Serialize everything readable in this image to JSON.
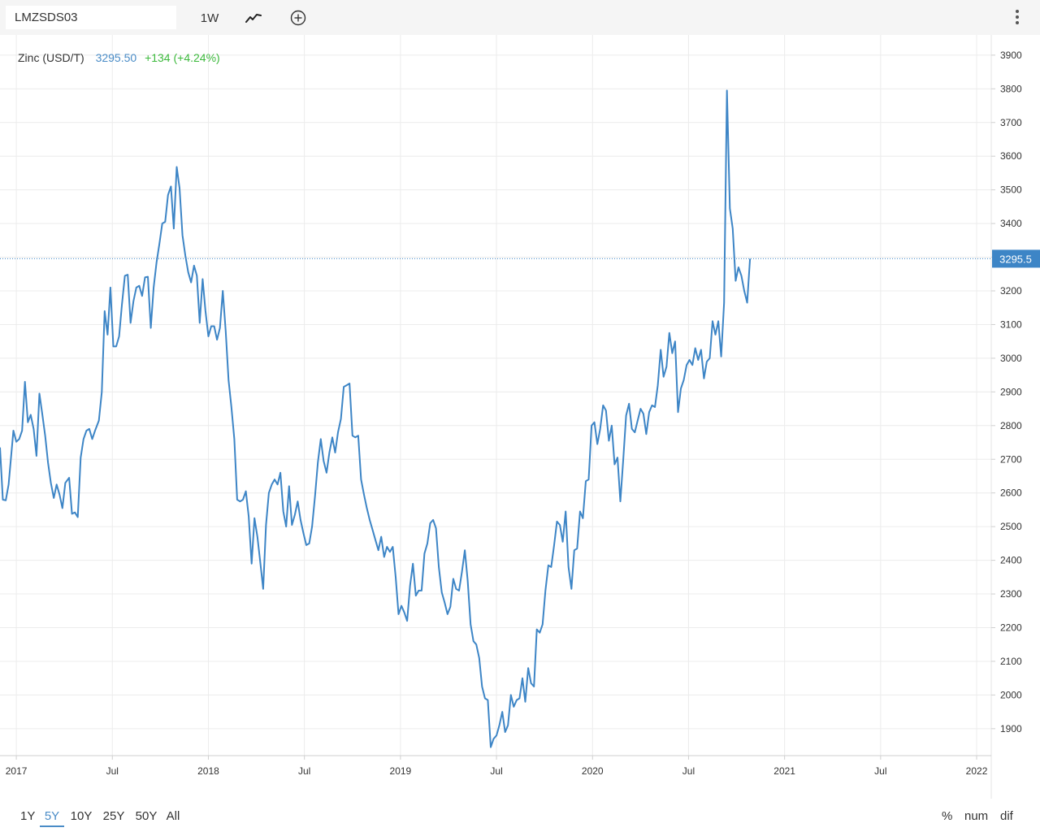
{
  "toolbar": {
    "symbol": "LMZSDS03",
    "interval": "1W",
    "icons": [
      "line-chart-icon",
      "add-circle-icon",
      "more-vert-icon"
    ]
  },
  "legend": {
    "name": "Zinc (USD/T)",
    "price": "3295.50",
    "change": "+134 (+4.24%)"
  },
  "periods": [
    {
      "label": "1Y",
      "active": false
    },
    {
      "label": "5Y",
      "active": true
    },
    {
      "label": "10Y",
      "active": false
    },
    {
      "label": "25Y",
      "active": false
    },
    {
      "label": "50Y",
      "active": false
    },
    {
      "label": "All",
      "active": false
    }
  ],
  "modes": [
    "%",
    "num",
    "dif"
  ],
  "colors": {
    "line": "#3d85c6",
    "positive": "#3cb93c",
    "accent": "#4a8cc7",
    "grid": "#ececec"
  },
  "chart_data": {
    "type": "line",
    "title": "",
    "xlabel": "",
    "ylabel": "",
    "ylim": [
      1820,
      3960
    ],
    "y_ticks": [
      1900,
      2000,
      2100,
      2200,
      2300,
      2400,
      2500,
      2600,
      2700,
      2800,
      2900,
      3000,
      3100,
      3200,
      3300,
      3400,
      3500,
      3600,
      3700,
      3800,
      3900
    ],
    "x_range": [
      2016.915,
      2022.076
    ],
    "x_ticks": [
      {
        "label": "2017",
        "x": 2017.0
      },
      {
        "label": "Jul",
        "x": 2017.5
      },
      {
        "label": "2018",
        "x": 2018.0
      },
      {
        "label": "Jul",
        "x": 2018.5
      },
      {
        "label": "2019",
        "x": 2019.0
      },
      {
        "label": "Jul",
        "x": 2019.5
      },
      {
        "label": "2020",
        "x": 2020.0
      },
      {
        "label": "Jul",
        "x": 2020.5
      },
      {
        "label": "2021",
        "x": 2021.0
      },
      {
        "label": "Jul",
        "x": 2021.5
      },
      {
        "label": "2022",
        "x": 2022.0
      }
    ],
    "last_value_label": "3295.5",
    "last_value": 3295.5,
    "grid": true,
    "series": [
      {
        "name": "Zinc (USD/T)",
        "points": [
          [
            2016.915,
            2735
          ],
          [
            2016.93,
            2580
          ],
          [
            2016.945,
            2578
          ],
          [
            2016.96,
            2625
          ],
          [
            2016.985,
            2785
          ],
          [
            2017.0,
            2752
          ],
          [
            2017.015,
            2760
          ],
          [
            2017.03,
            2785
          ],
          [
            2017.045,
            2930
          ],
          [
            2017.06,
            2810
          ],
          [
            2017.075,
            2832
          ],
          [
            2017.09,
            2790
          ],
          [
            2017.105,
            2710
          ],
          [
            2017.12,
            2895
          ],
          [
            2017.135,
            2835
          ],
          [
            2017.15,
            2770
          ],
          [
            2017.165,
            2690
          ],
          [
            2017.18,
            2630
          ],
          [
            2017.195,
            2585
          ],
          [
            2017.21,
            2625
          ],
          [
            2017.225,
            2595
          ],
          [
            2017.24,
            2555
          ],
          [
            2017.255,
            2630
          ],
          [
            2017.275,
            2645
          ],
          [
            2017.29,
            2538
          ],
          [
            2017.305,
            2542
          ],
          [
            2017.32,
            2528
          ],
          [
            2017.335,
            2705
          ],
          [
            2017.35,
            2760
          ],
          [
            2017.365,
            2785
          ],
          [
            2017.38,
            2790
          ],
          [
            2017.395,
            2760
          ],
          [
            2017.41,
            2785
          ],
          [
            2017.43,
            2815
          ],
          [
            2017.445,
            2900
          ],
          [
            2017.46,
            3140
          ],
          [
            2017.475,
            3070
          ],
          [
            2017.49,
            3210
          ],
          [
            2017.505,
            3035
          ],
          [
            2017.52,
            3035
          ],
          [
            2017.535,
            3065
          ],
          [
            2017.55,
            3160
          ],
          [
            2017.565,
            3245
          ],
          [
            2017.58,
            3248
          ],
          [
            2017.595,
            3105
          ],
          [
            2017.61,
            3170
          ],
          [
            2017.625,
            3210
          ],
          [
            2017.64,
            3215
          ],
          [
            2017.655,
            3185
          ],
          [
            2017.67,
            3240
          ],
          [
            2017.685,
            3242
          ],
          [
            2017.7,
            3090
          ],
          [
            2017.715,
            3210
          ],
          [
            2017.73,
            3285
          ],
          [
            2017.745,
            3340
          ],
          [
            2017.76,
            3400
          ],
          [
            2017.775,
            3405
          ],
          [
            2017.79,
            3485
          ],
          [
            2017.805,
            3510
          ],
          [
            2017.82,
            3385
          ],
          [
            2017.835,
            3568
          ],
          [
            2017.85,
            3505
          ],
          [
            2017.865,
            3365
          ],
          [
            2017.88,
            3305
          ],
          [
            2017.895,
            3255
          ],
          [
            2017.91,
            3225
          ],
          [
            2017.925,
            3275
          ],
          [
            2017.94,
            3245
          ],
          [
            2017.955,
            3105
          ],
          [
            2017.97,
            3235
          ],
          [
            2017.985,
            3140
          ],
          [
            2018.0,
            3065
          ],
          [
            2018.015,
            3095
          ],
          [
            2018.03,
            3095
          ],
          [
            2018.045,
            3055
          ],
          [
            2018.06,
            3090
          ],
          [
            2018.075,
            3200
          ],
          [
            2018.09,
            3080
          ],
          [
            2018.105,
            2935
          ],
          [
            2018.12,
            2855
          ],
          [
            2018.135,
            2760
          ],
          [
            2018.15,
            2580
          ],
          [
            2018.165,
            2575
          ],
          [
            2018.18,
            2580
          ],
          [
            2018.195,
            2605
          ],
          [
            2018.21,
            2530
          ],
          [
            2018.225,
            2390
          ],
          [
            2018.24,
            2525
          ],
          [
            2018.255,
            2470
          ],
          [
            2018.27,
            2395
          ],
          [
            2018.285,
            2315
          ],
          [
            2018.3,
            2505
          ],
          [
            2018.315,
            2600
          ],
          [
            2018.33,
            2625
          ],
          [
            2018.345,
            2640
          ],
          [
            2018.36,
            2625
          ],
          [
            2018.375,
            2660
          ],
          [
            2018.39,
            2545
          ],
          [
            2018.405,
            2500
          ],
          [
            2018.42,
            2620
          ],
          [
            2018.435,
            2505
          ],
          [
            2018.45,
            2535
          ],
          [
            2018.465,
            2575
          ],
          [
            2018.48,
            2520
          ],
          [
            2018.495,
            2480
          ],
          [
            2018.51,
            2445
          ],
          [
            2018.525,
            2450
          ],
          [
            2018.54,
            2500
          ],
          [
            2018.555,
            2590
          ],
          [
            2018.57,
            2690
          ],
          [
            2018.585,
            2760
          ],
          [
            2018.6,
            2695
          ],
          [
            2018.615,
            2660
          ],
          [
            2018.63,
            2720
          ],
          [
            2018.645,
            2765
          ],
          [
            2018.66,
            2720
          ],
          [
            2018.675,
            2780
          ],
          [
            2018.69,
            2820
          ],
          [
            2018.705,
            2915
          ],
          [
            2018.72,
            2920
          ],
          [
            2018.735,
            2925
          ],
          [
            2018.75,
            2770
          ],
          [
            2018.765,
            2765
          ],
          [
            2018.78,
            2770
          ],
          [
            2018.795,
            2640
          ],
          [
            2018.81,
            2595
          ],
          [
            2018.825,
            2555
          ],
          [
            2018.84,
            2520
          ],
          [
            2018.855,
            2490
          ],
          [
            2018.87,
            2460
          ],
          [
            2018.885,
            2430
          ],
          [
            2018.9,
            2470
          ],
          [
            2018.915,
            2410
          ],
          [
            2018.93,
            2440
          ],
          [
            2018.945,
            2425
          ],
          [
            2018.96,
            2440
          ],
          [
            2018.975,
            2350
          ],
          [
            2018.99,
            2240
          ],
          [
            2019.005,
            2265
          ],
          [
            2019.02,
            2245
          ],
          [
            2019.035,
            2220
          ],
          [
            2019.05,
            2325
          ],
          [
            2019.065,
            2390
          ],
          [
            2019.08,
            2295
          ],
          [
            2019.095,
            2310
          ],
          [
            2019.11,
            2310
          ],
          [
            2019.125,
            2420
          ],
          [
            2019.14,
            2450
          ],
          [
            2019.155,
            2510
          ],
          [
            2019.17,
            2520
          ],
          [
            2019.185,
            2495
          ],
          [
            2019.2,
            2380
          ],
          [
            2019.215,
            2305
          ],
          [
            2019.23,
            2275
          ],
          [
            2019.245,
            2240
          ],
          [
            2019.26,
            2262
          ],
          [
            2019.275,
            2345
          ],
          [
            2019.29,
            2315
          ],
          [
            2019.305,
            2310
          ],
          [
            2019.32,
            2365
          ],
          [
            2019.335,
            2430
          ],
          [
            2019.35,
            2340
          ],
          [
            2019.365,
            2210
          ],
          [
            2019.38,
            2160
          ],
          [
            2019.395,
            2150
          ],
          [
            2019.41,
            2110
          ],
          [
            2019.425,
            2025
          ],
          [
            2019.44,
            1990
          ],
          [
            2019.455,
            1985
          ],
          [
            2019.47,
            1845
          ],
          [
            2019.485,
            1870
          ],
          [
            2019.5,
            1880
          ],
          [
            2019.515,
            1910
          ],
          [
            2019.53,
            1950
          ],
          [
            2019.545,
            1890
          ],
          [
            2019.56,
            1910
          ],
          [
            2019.575,
            2000
          ],
          [
            2019.59,
            1965
          ],
          [
            2019.605,
            1985
          ],
          [
            2019.62,
            1990
          ],
          [
            2019.635,
            2050
          ],
          [
            2019.65,
            1980
          ],
          [
            2019.665,
            2080
          ],
          [
            2019.68,
            2035
          ],
          [
            2019.695,
            2025
          ],
          [
            2019.71,
            2195
          ],
          [
            2019.725,
            2185
          ],
          [
            2019.74,
            2210
          ],
          [
            2019.755,
            2310
          ],
          [
            2019.77,
            2385
          ],
          [
            2019.785,
            2380
          ],
          [
            2019.8,
            2445
          ],
          [
            2019.815,
            2515
          ],
          [
            2019.83,
            2505
          ],
          [
            2019.845,
            2455
          ],
          [
            2019.86,
            2545
          ],
          [
            2019.875,
            2380
          ],
          [
            2019.89,
            2315
          ],
          [
            2019.905,
            2430
          ],
          [
            2019.92,
            2435
          ],
          [
            2019.935,
            2545
          ],
          [
            2019.95,
            2525
          ],
          [
            2019.965,
            2635
          ],
          [
            2019.98,
            2640
          ],
          [
            2019.995,
            2800
          ],
          [
            2020.01,
            2810
          ],
          [
            2020.025,
            2745
          ],
          [
            2020.04,
            2790
          ],
          [
            2020.055,
            2860
          ],
          [
            2020.07,
            2845
          ],
          [
            2020.085,
            2755
          ],
          [
            2020.1,
            2800
          ],
          [
            2020.115,
            2685
          ],
          [
            2020.13,
            2705
          ],
          [
            2020.145,
            2575
          ],
          [
            2020.16,
            2700
          ],
          [
            2020.175,
            2830
          ],
          [
            2020.19,
            2865
          ],
          [
            2020.205,
            2790
          ],
          [
            2020.22,
            2780
          ],
          [
            2020.235,
            2815
          ],
          [
            2020.25,
            2850
          ],
          [
            2020.265,
            2835
          ],
          [
            2020.28,
            2775
          ],
          [
            2020.295,
            2840
          ],
          [
            2020.31,
            2860
          ],
          [
            2020.325,
            2855
          ],
          [
            2020.34,
            2920
          ],
          [
            2020.355,
            3025
          ],
          [
            2020.37,
            2945
          ],
          [
            2020.385,
            2975
          ],
          [
            2020.4,
            3075
          ],
          [
            2020.415,
            3015
          ],
          [
            2020.43,
            3050
          ],
          [
            2020.445,
            2840
          ],
          [
            2020.46,
            2910
          ],
          [
            2020.475,
            2935
          ],
          [
            2020.49,
            2980
          ],
          [
            2020.505,
            2995
          ],
          [
            2020.52,
            2980
          ],
          [
            2020.535,
            3030
          ],
          [
            2020.55,
            2995
          ],
          [
            2020.565,
            3025
          ],
          [
            2020.58,
            2940
          ],
          [
            2020.595,
            2990
          ],
          [
            2020.61,
            3000
          ],
          [
            2020.625,
            3110
          ],
          [
            2020.64,
            3070
          ],
          [
            2020.655,
            3110
          ],
          [
            2020.67,
            3005
          ],
          [
            2020.685,
            3165
          ],
          [
            2020.7,
            3795
          ],
          [
            2020.715,
            3445
          ],
          [
            2020.73,
            3385
          ],
          [
            2020.745,
            3230
          ],
          [
            2020.76,
            3270
          ],
          [
            2020.775,
            3245
          ],
          [
            2020.79,
            3200
          ],
          [
            2020.805,
            3165
          ],
          [
            2020.82,
            3295.5
          ]
        ]
      }
    ]
  }
}
